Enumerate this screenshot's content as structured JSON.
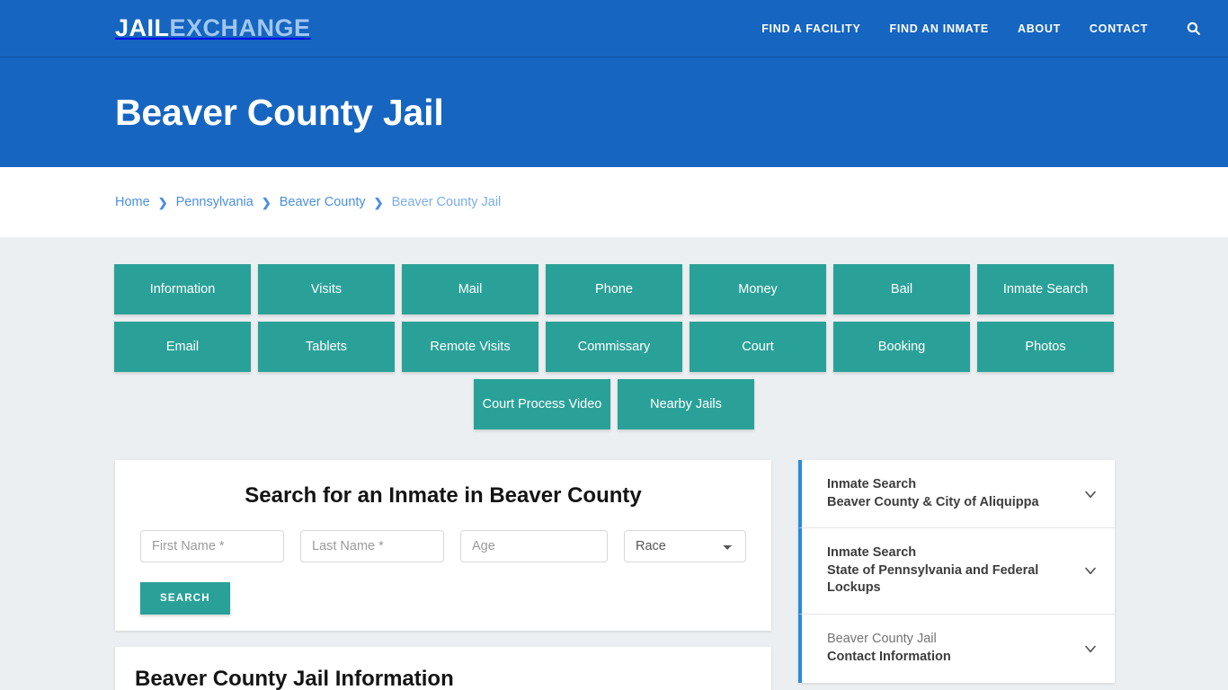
{
  "header": {
    "logo_primary": "JAIL",
    "logo_secondary": "EXCHANGE",
    "nav": [
      {
        "label": "FIND A FACILITY"
      },
      {
        "label": "FIND AN INMATE"
      },
      {
        "label": "ABOUT"
      },
      {
        "label": "CONTACT"
      }
    ],
    "search_icon": "search-icon",
    "brand_color": "#1665c1"
  },
  "hero": {
    "title": "Beaver County Jail"
  },
  "breadcrumb": {
    "separator": "❯",
    "items": [
      {
        "label": "Home"
      },
      {
        "label": "Pennsylvania"
      },
      {
        "label": "Beaver County"
      },
      {
        "label": "Beaver County Jail"
      }
    ]
  },
  "tiles": {
    "accent_color": "#2aa198",
    "row1": [
      {
        "label": "Information"
      },
      {
        "label": "Visits"
      },
      {
        "label": "Mail"
      },
      {
        "label": "Phone"
      },
      {
        "label": "Money"
      },
      {
        "label": "Bail"
      },
      {
        "label": "Inmate Search"
      }
    ],
    "row2": [
      {
        "label": "Email"
      },
      {
        "label": "Tablets"
      },
      {
        "label": "Remote Visits"
      },
      {
        "label": "Commissary"
      },
      {
        "label": "Court"
      },
      {
        "label": "Booking"
      },
      {
        "label": "Photos"
      }
    ],
    "row3": [
      {
        "label": "Court Process Video"
      },
      {
        "label": "Nearby Jails"
      }
    ]
  },
  "search_form": {
    "title": "Search for an Inmate in Beaver County",
    "first_name_placeholder": "First Name *",
    "first_name_value": "",
    "last_name_placeholder": "Last Name *",
    "last_name_value": "",
    "age_placeholder": "Age",
    "age_value": "",
    "race_selected": "Race",
    "race_options": [
      "Race"
    ],
    "submit_label": "SEARCH"
  },
  "info_card": {
    "title": "Beaver County Jail Information"
  },
  "sidebar": {
    "accent_color": "#2a8bd8",
    "items": [
      {
        "line1": "Inmate Search",
        "line2": "Beaver County & City of Aliquippa",
        "line1_light": false,
        "icon": "chevron-down-icon"
      },
      {
        "line1": "Inmate Search",
        "line2": "State of Pennsylvania and Federal Lockups",
        "line1_light": false,
        "icon": "chevron-down-icon"
      },
      {
        "line1": "Beaver County Jail",
        "line2": "Contact Information",
        "line1_light": true,
        "icon": "chevron-down-icon"
      }
    ]
  }
}
